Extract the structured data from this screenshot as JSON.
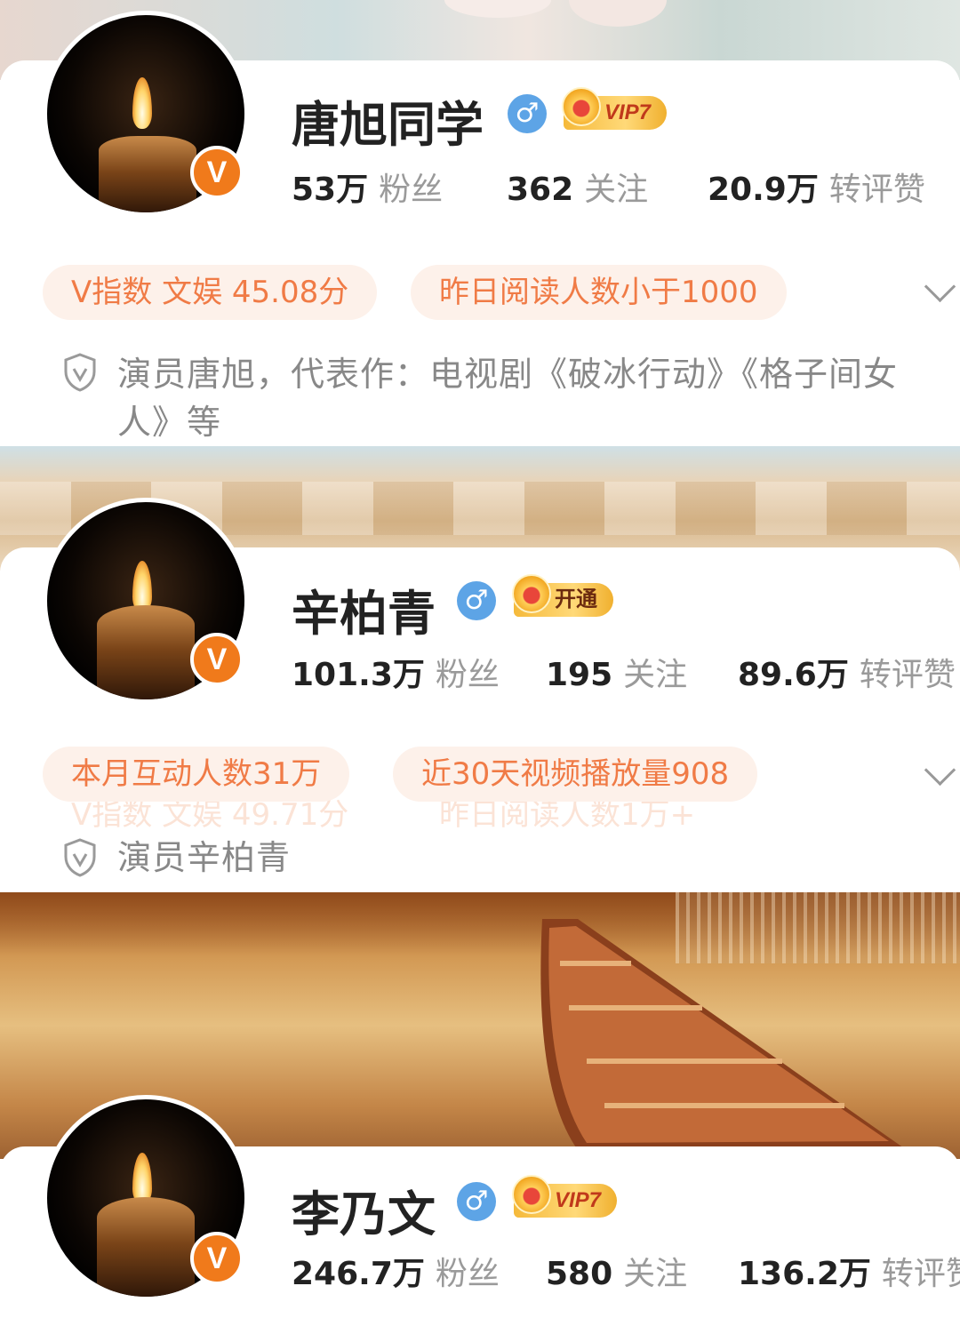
{
  "profiles": [
    {
      "name": "唐旭同学",
      "gender_symbol": "♂",
      "vip_label": "VIP7",
      "verified_badge": "V",
      "stats": [
        {
          "value": "53万",
          "label": "粉丝"
        },
        {
          "value": "362",
          "label": "关注"
        },
        {
          "value": "20.9万",
          "label": "转评赞"
        }
      ],
      "chips": [
        "V指数 文娱 45.08分",
        "昨日阅读人数小于1000"
      ],
      "intro": "演员唐旭，代表作：电视剧《破冰行动》《格子间女人》等"
    },
    {
      "name": "辛柏青",
      "gender_symbol": "♂",
      "vip_label": "开通",
      "verified_badge": "V",
      "stats": [
        {
          "value": "101.3万",
          "label": "粉丝"
        },
        {
          "value": "195",
          "label": "关注"
        },
        {
          "value": "89.6万",
          "label": "转评赞"
        }
      ],
      "chips": [
        "本月互动人数31万",
        "近30天视频播放量908"
      ],
      "ghost_chips": [
        "V指数 文娱 49.71分",
        "昨日阅读人数1万+"
      ],
      "intro": "演员辛柏青"
    },
    {
      "name": "李乃文",
      "gender_symbol": "♂",
      "vip_label": "VIP7",
      "verified_badge": "V",
      "stats": [
        {
          "value": "246.7万",
          "label": "粉丝"
        },
        {
          "value": "580",
          "label": "关注"
        },
        {
          "value": "136.2万",
          "label": "转评赞"
        }
      ]
    }
  ],
  "colors": {
    "accent_orange": "#f07b46",
    "chip_bg": "#fdf1ea",
    "verified_orange": "#f07a1b",
    "gender_blue": "#5da4e6",
    "vip_gold": "#f5b93a"
  }
}
